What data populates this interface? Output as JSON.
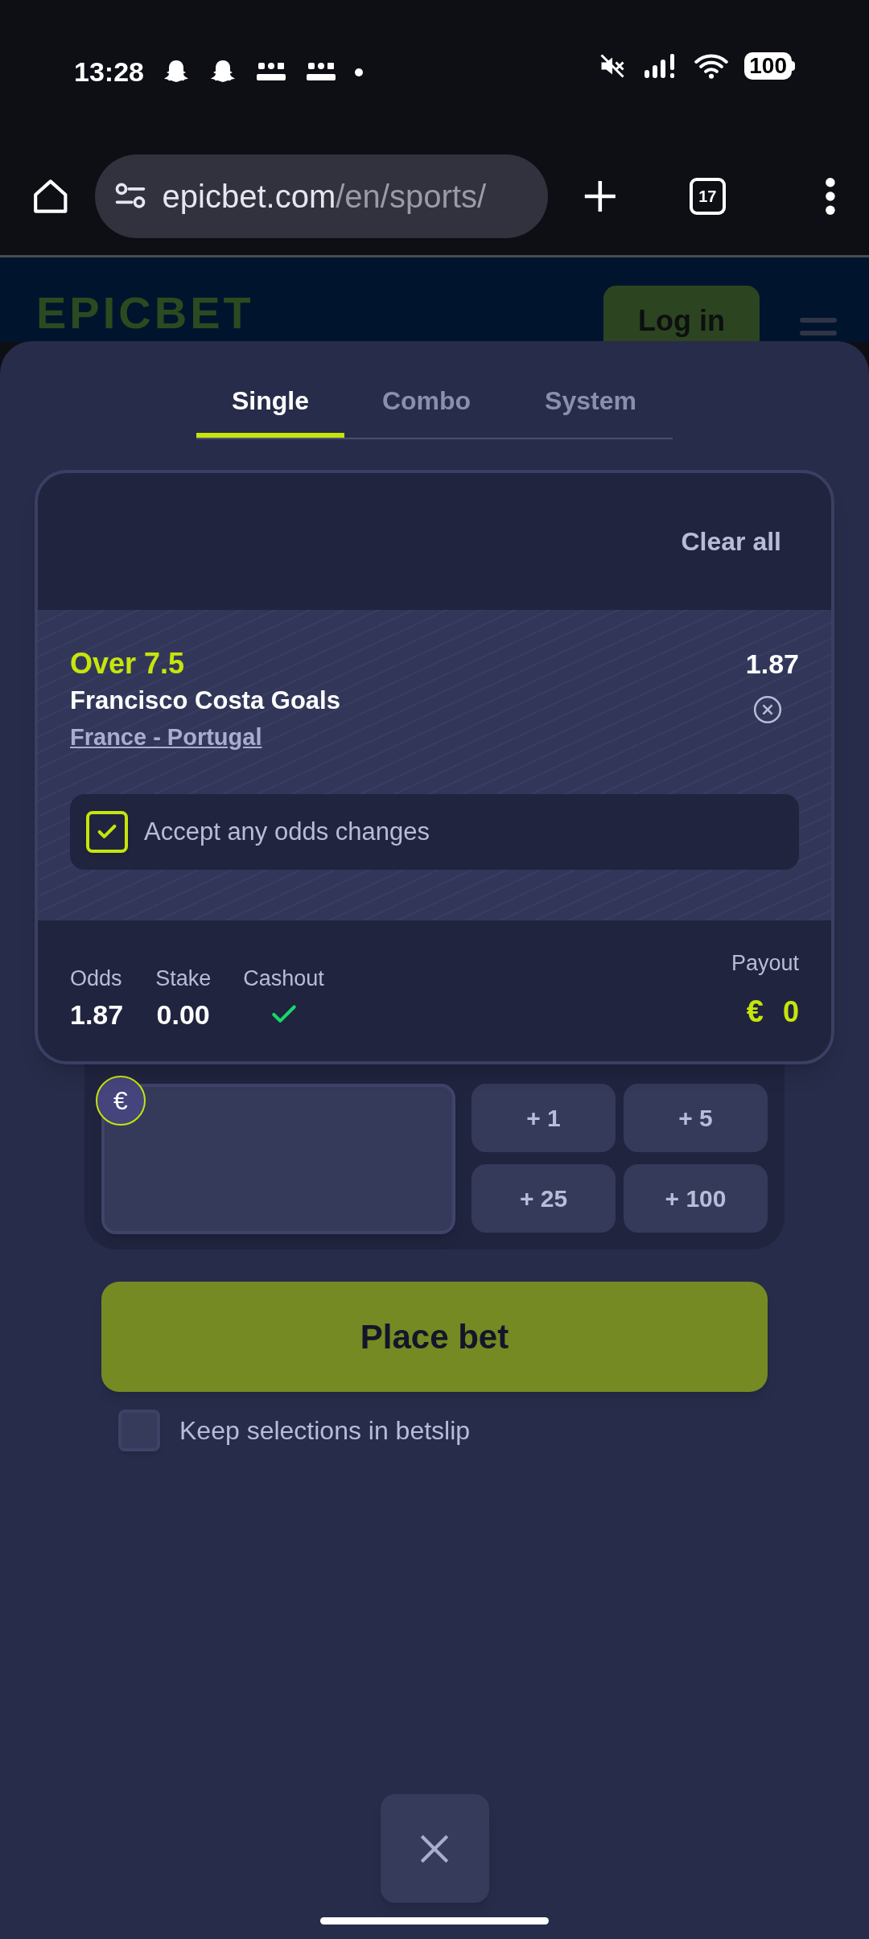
{
  "status_bar": {
    "time": "13:28",
    "battery": "100"
  },
  "browser": {
    "url_host": "epicbet.com",
    "url_path": "/en/sports/",
    "tab_count": "17"
  },
  "site_header": {
    "logo": "EPICBET",
    "login": "Log in"
  },
  "tabs": [
    {
      "label": "Single",
      "selected": true
    },
    {
      "label": "Combo",
      "selected": false
    },
    {
      "label": "System",
      "selected": false
    }
  ],
  "betslip": {
    "clear_all": "Clear all",
    "selection": {
      "pick": "Over 7.5",
      "market": "Francisco Costa Goals",
      "event": "France - Portugal",
      "odds": "1.87"
    },
    "accept_odds": {
      "label": "Accept any odds changes",
      "checked": true
    },
    "summary": {
      "odds_label": "Odds",
      "odds": "1.87",
      "stake_label": "Stake",
      "stake": "0.00",
      "cashout_label": "Cashout",
      "cashout_available": true,
      "payout_label": "Payout",
      "payout_currency": "€",
      "payout": "0"
    }
  },
  "stake": {
    "currency": "€",
    "quick_amounts": [
      "+ 1",
      "+ 5",
      "+ 25",
      "+ 100"
    ]
  },
  "place_bet": "Place bet",
  "keep_selections": {
    "label": "Keep selections in betslip",
    "checked": false
  }
}
